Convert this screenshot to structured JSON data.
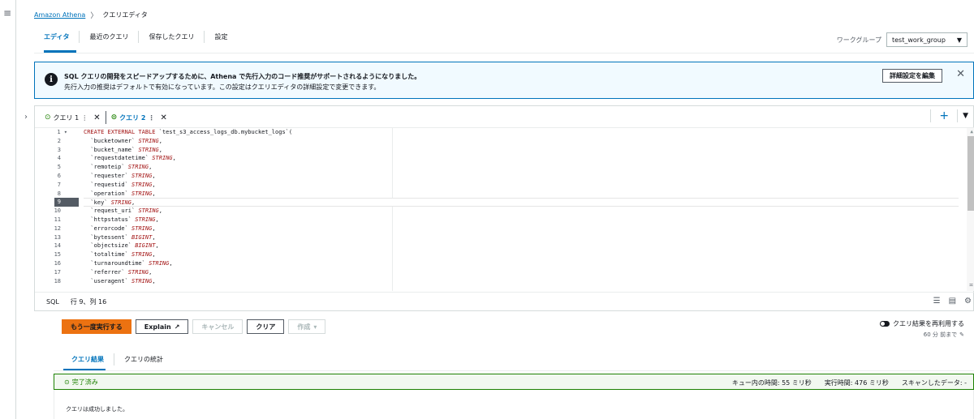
{
  "breadcrumb": {
    "home": "Amazon Athena",
    "separator": "〉",
    "current": "クエリエディタ"
  },
  "tabs": [
    "エディタ",
    "最近のクエリ",
    "保存したクエリ",
    "設定"
  ],
  "workgroup": {
    "label": "ワークグループ",
    "value": "test_work_group"
  },
  "banner": {
    "title": "SQL クエリの開発をスピードアップするために、Athena で先行入力のコード推奨がサポートされるようになりました。",
    "body": "先行入力の推奨はデフォルトで有効になっています。この設定はクエリエディタの詳細設定で変更できます。",
    "button": "詳細設定を編集"
  },
  "query_tabs": [
    {
      "label": "クエリ 1",
      "active": false
    },
    {
      "label": "クエリ 2",
      "active": true
    }
  ],
  "code": {
    "lines": [
      {
        "n": "1",
        "col": "`test_s3_access_logs_db.mybucket_logs`("
      },
      {
        "n": "2",
        "col": "bucketowner",
        "type": "STRING"
      },
      {
        "n": "3",
        "col": "bucket_name",
        "type": "STRING"
      },
      {
        "n": "4",
        "col": "requestdatetime",
        "type": "STRING"
      },
      {
        "n": "5",
        "col": "remoteip",
        "type": "STRING"
      },
      {
        "n": "6",
        "col": "requester",
        "type": "STRING"
      },
      {
        "n": "7",
        "col": "requestid",
        "type": "STRING"
      },
      {
        "n": "8",
        "col": "operation",
        "type": "STRING"
      },
      {
        "n": "9",
        "col": "key",
        "type": "STRING"
      },
      {
        "n": "10",
        "col": "request_uri",
        "type": "STRING"
      },
      {
        "n": "11",
        "col": "httpstatus",
        "type": "STRING"
      },
      {
        "n": "12",
        "col": "errorcode",
        "type": "STRING"
      },
      {
        "n": "13",
        "col": "bytessent",
        "type": "BIGINT"
      },
      {
        "n": "14",
        "col": "objectsize",
        "type": "BIGINT"
      },
      {
        "n": "15",
        "col": "totaltime",
        "type": "STRING"
      },
      {
        "n": "16",
        "col": "turnaroundtime",
        "type": "STRING"
      },
      {
        "n": "17",
        "col": "referrer",
        "type": "STRING"
      },
      {
        "n": "18",
        "col": "useragent",
        "type": "STRING"
      }
    ],
    "keyword_line1": "CREATE EXTERNAL TABLE",
    "current_line": "9"
  },
  "status": {
    "lang": "SQL",
    "position": "行 9、列 16"
  },
  "actions": {
    "run": "もう一度実行する",
    "explain": "Explain",
    "cancel": "キャンセル",
    "clear": "クリア",
    "create": "作成"
  },
  "reuse": {
    "label": "クエリ結果を再利用する",
    "sub": "60 分 前まで"
  },
  "result_tabs": [
    "クエリ結果",
    "クエリの統計"
  ],
  "result": {
    "status": "完了済み",
    "queue_time": "キュー内の時間: 55 ミリ秒",
    "run_time": "実行時間: 476 ミリ秒",
    "scanned": "スキャンしたデータ: -",
    "message": "クエリは成功しました。"
  }
}
